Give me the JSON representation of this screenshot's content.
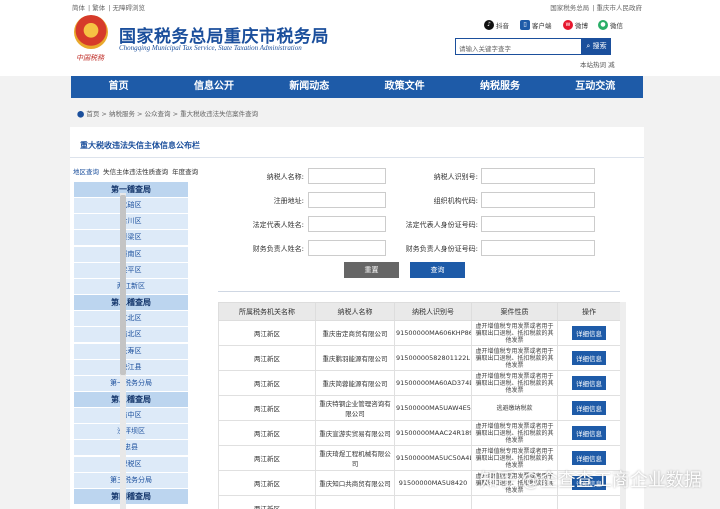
{
  "topbar": {
    "left": [
      "简体",
      "繁体",
      "无障碍浏览"
    ],
    "right": [
      "国家税务总局",
      "重庆市人民政府"
    ]
  },
  "header": {
    "emblem_text": "中国税務",
    "title": "国家税务总局重庆市税务局",
    "subtitle": "Chongqing Municipal Tax Service, State Taxation Administration",
    "social": [
      {
        "label": "抖音",
        "icon": "douyin-icon",
        "color": "#111111"
      },
      {
        "label": "客户端",
        "icon": "app-icon",
        "color": "#1e5ba8"
      },
      {
        "label": "微博",
        "icon": "weibo-icon",
        "color": "#e6162d"
      },
      {
        "label": "微信",
        "icon": "wechat-icon",
        "color": "#2aae67"
      }
    ],
    "search_placeholder": "请输入关键字查字",
    "search_button": "搜索",
    "note": "本站热词  减"
  },
  "nav": [
    "首页",
    "信息公开",
    "新闻动态",
    "政策文件",
    "纳税服务",
    "互动交流"
  ],
  "breadcrumb": [
    "首页",
    "纳税服务",
    "公众查询",
    "重大税收违法失信案件查询"
  ],
  "panel_title": "重大税收违法失信主体信息公布栏",
  "side_tabs": [
    "地区查询",
    "失信主体违法性质查询",
    "年度查询"
  ],
  "side_list": [
    {
      "type": "cat",
      "label": "第一稽查局"
    },
    {
      "type": "item",
      "label": "北碚区"
    },
    {
      "type": "item",
      "label": "合川区"
    },
    {
      "type": "item",
      "label": "璧梁区"
    },
    {
      "type": "item",
      "label": "潼南区"
    },
    {
      "type": "item",
      "label": "梁平区"
    },
    {
      "type": "item",
      "label": "两江新区"
    },
    {
      "type": "cat",
      "label": "第二稽查局"
    },
    {
      "type": "item",
      "label": "江北区"
    },
    {
      "type": "item",
      "label": "渝北区"
    },
    {
      "type": "item",
      "label": "长寿区"
    },
    {
      "type": "item",
      "label": "垫江县"
    },
    {
      "type": "item",
      "label": "第一税务分局"
    },
    {
      "type": "cat",
      "label": "第三稽查局"
    },
    {
      "type": "item",
      "label": "渝中区"
    },
    {
      "type": "item",
      "label": "沙坪坝区"
    },
    {
      "type": "item",
      "label": "忠县"
    },
    {
      "type": "item",
      "label": "保税区"
    },
    {
      "type": "item",
      "label": "第三税务分局"
    },
    {
      "type": "cat",
      "label": "第四稽查局"
    }
  ],
  "form": {
    "name": "纳税人名称:",
    "taxid": "纳税人识别号:",
    "address": "注册地址:",
    "orgcode": "组织机构代码:",
    "legal_name": "法定代表人姓名:",
    "legal_id": "法定代表人身份证号码:",
    "fin_name": "财务负责人姓名:",
    "fin_id": "财务负责人身份证号码:",
    "reset": "重置",
    "query": "查询"
  },
  "table": {
    "headers": [
      "所属税务机关名称",
      "纳税人名称",
      "纳税人识别号",
      "案件性质",
      "操作"
    ],
    "rows": [
      {
        "office": "两江新区",
        "name": "重庆宙定商贸有限公司",
        "taxid": "91500000MA606KHP86",
        "nature": "虚开增值税专用发票或者用于骗取出口退税、抵扣税款的其他发票",
        "action": "详细信息"
      },
      {
        "office": "两江新区",
        "name": "重庆鹏羽能源有限公司",
        "taxid": "91500000582801122L",
        "nature": "虚开增值税专用发票或者用于骗取出口退税、抵扣税款的其他发票",
        "action": "详细信息"
      },
      {
        "office": "两江新区",
        "name": "重庆简蓉能源有限公司",
        "taxid": "91500000MA60AD374D",
        "nature": "虚开增值税专用发票或者用于骗取出口退税、抵扣税款的其他发票",
        "action": "详细信息"
      },
      {
        "office": "两江新区",
        "name": "重庆特钢企业管理咨询有限公司",
        "taxid": "91500000MA5UAW4E59",
        "nature": "逃避缴纳税款",
        "action": "详细信息"
      },
      {
        "office": "两江新区",
        "name": "重庆宣游实贸易有限公司",
        "taxid": "91500000MAAC24R189",
        "nature": "虚开增值税专用发票或者用于骗取出口退税、抵扣税款的其他发票",
        "action": "详细信息"
      },
      {
        "office": "两江新区",
        "name": "重庆琦煜工程机械有限公司",
        "taxid": "91500000MA5UC50A4L",
        "nature": "虚开增值税专用发票或者用于骗取出口退税、抵扣税款的其他发票",
        "action": "详细信息"
      },
      {
        "office": "两江新区",
        "name": "重庆知口共商贸有限公司",
        "taxid": "91500000MA5U8420",
        "nature": "虚开增值税专用发票或者用于骗取出口退税、抵扣税款的其他发票",
        "action": "详细信息"
      },
      {
        "office": "两江新区",
        "name": "",
        "taxid": "",
        "nature": "",
        "action": ""
      }
    ]
  },
  "watermark": "知乎 @企查查工商企业数据"
}
